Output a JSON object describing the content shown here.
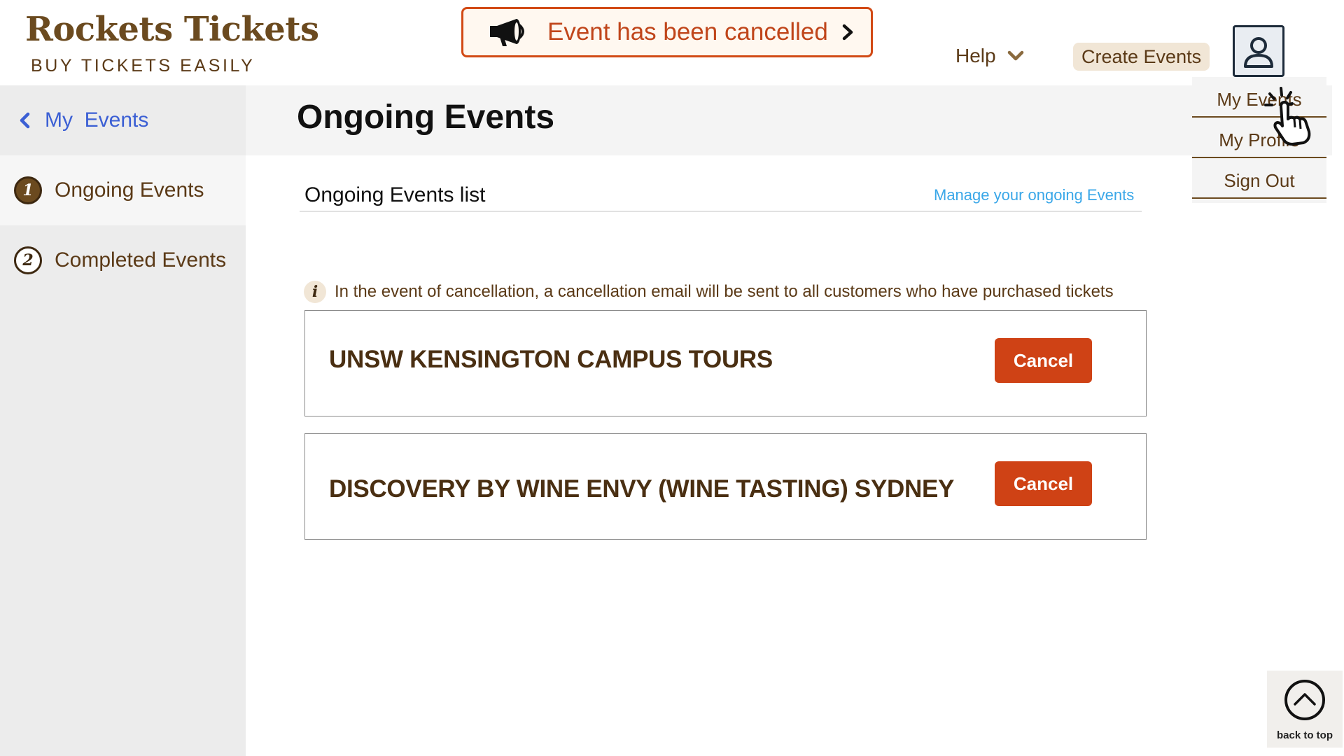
{
  "header": {
    "brand_title": "Rockets Tickets",
    "brand_tagline": "BUY TICKETS EASILY",
    "alert_text": "Event has been cancelled",
    "help_label": "Help",
    "create_events_label": "Create Events"
  },
  "dropdown": {
    "items": [
      "My Events",
      "My Profile",
      "Sign Out"
    ]
  },
  "sidebar": {
    "back_label": "My  Events",
    "items": [
      {
        "number": "1",
        "label": "Ongoing Events"
      },
      {
        "number": "2",
        "label": "Completed Events"
      }
    ]
  },
  "main": {
    "page_title": "Ongoing Events",
    "list_title": "Ongoing Events list",
    "manage_link": "Manage your ongoing Events",
    "info_note": "In the event of cancellation, a cancellation email will be sent to all customers who have purchased tickets",
    "events": [
      {
        "name": "UNSW KENSINGTON CAMPUS TOURS",
        "action": "Cancel"
      },
      {
        "name": "DISCOVERY BY WINE ENVY (WINE TASTING) SYDNEY",
        "action": "Cancel"
      }
    ]
  },
  "back_to_top_label": "back to top",
  "icons": {
    "alert": "megaphone-icon",
    "alert_chevron": "chevron-right-icon",
    "help": "chevron-down-icon",
    "avatar": "user-icon",
    "back": "chevron-left-icon",
    "pointer": "hand-pointer-icon",
    "info": "info-icon",
    "back_to_top": "arrow-up-circle-icon"
  },
  "colors": {
    "brand_brown": "#6b4a1f",
    "alert_orange": "#d24a15",
    "cancel_button": "#cf4215",
    "link_blue": "#3aa7e8",
    "sidebar_back_blue": "#3b5fd4"
  }
}
